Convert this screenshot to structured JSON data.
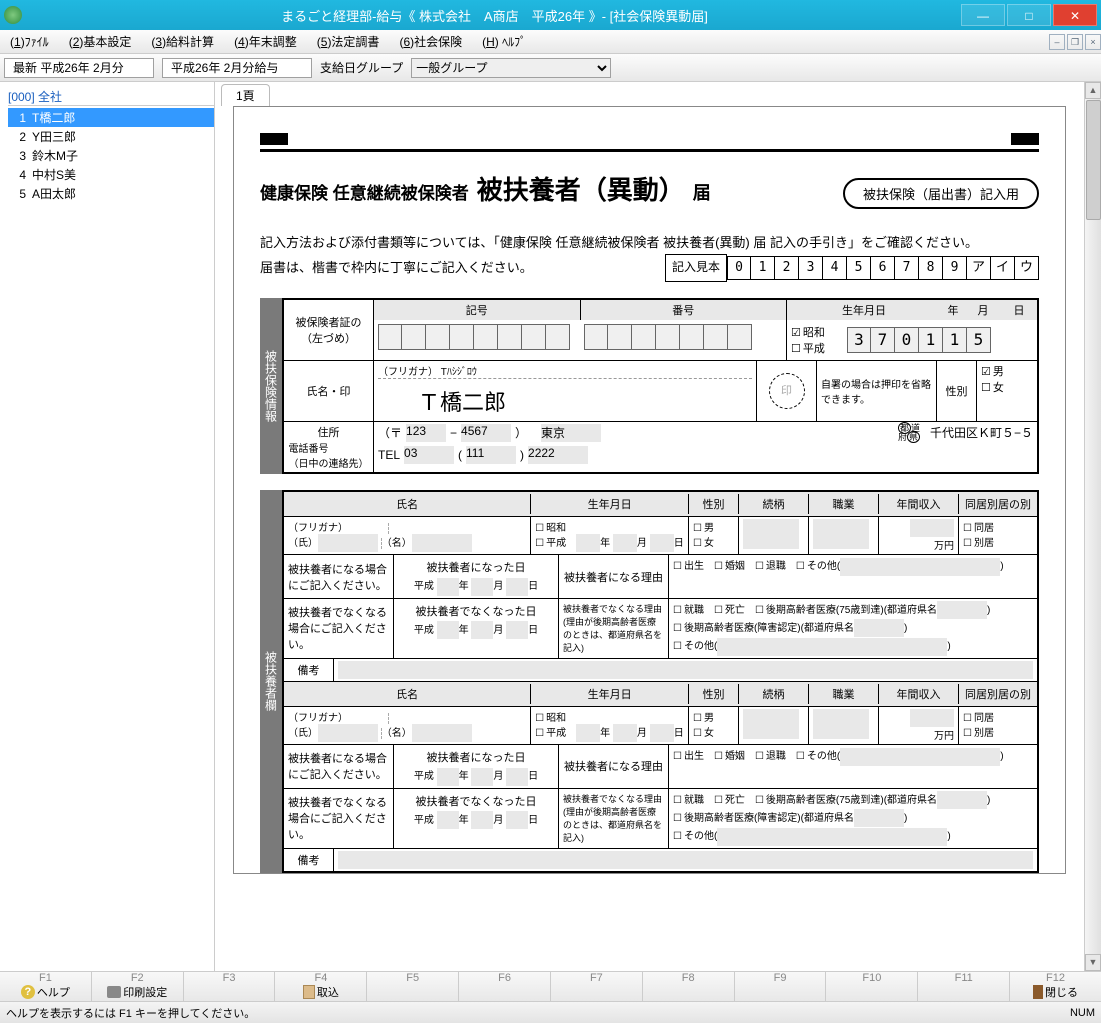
{
  "titlebar": {
    "title": "まるごと経理部-給与《 株式会社　A商店　平成26年 》- [社会保険異動届]"
  },
  "menu": [
    {
      "u": "1",
      "t": ")ﾌｧｲﾙ"
    },
    {
      "u": "2",
      "t": ")基本設定"
    },
    {
      "u": "3",
      "t": ")給料計算"
    },
    {
      "u": "4",
      "t": ")年末調整"
    },
    {
      "u": "5",
      "t": ")法定調書"
    },
    {
      "u": "6",
      "t": ")社会保険"
    },
    {
      "u": "H",
      "t": ") ﾍﾙﾌﾟ"
    }
  ],
  "toolbar": {
    "field1": "最新 平成26年 2月分",
    "field2": "平成26年 2月分給与",
    "label": "支給日グループ",
    "select": "一般グループ"
  },
  "sidebar": {
    "header": "[000] 全社",
    "items": [
      {
        "n": "1",
        "name": "T橋二郎",
        "sel": true
      },
      {
        "n": "2",
        "name": "Y田三郎"
      },
      {
        "n": "3",
        "name": "鈴木M子"
      },
      {
        "n": "4",
        "name": "中村S美"
      },
      {
        "n": "5",
        "name": "A田太郎"
      }
    ]
  },
  "doc": {
    "tab": "1頁",
    "title_small": "健康保険 任意継続被保険者",
    "title_big": "被扶養者（異動）",
    "title_med": "届",
    "badge": "被扶保険（届出書）記入用",
    "instr1": "記入方法および添付書類等については、「健康保険 任意継続被保険者 被扶養者(異動) 届 記入の手引き」をご確認ください。",
    "instr2": "届書は、楷書で枠内に丁寧にご記入ください。",
    "sample_label": "記入見本",
    "sample_boxes": [
      "0",
      "1",
      "2",
      "3",
      "4",
      "5",
      "6",
      "7",
      "8",
      "9",
      "ア",
      "イ",
      "ウ"
    ],
    "section1_label": "被扶保険情報",
    "kigou": "記号",
    "bangou": "番号",
    "birth": "生年月日",
    "year": "年",
    "month": "月",
    "day": "日",
    "showa": "昭和",
    "heisei": "平成",
    "birth_digits": [
      "3",
      "7",
      "0",
      "1",
      "1",
      "5"
    ],
    "hihokensha_label": "被保険者証の\n（左づめ）",
    "furigana_label": "（フリガナ）",
    "furigana": "Tﾊｼｼﾞﾛｳ",
    "name_label": "氏名・印",
    "name": "Ｔ橋二郎",
    "seal": "印",
    "seal_note": "自署の場合は押印を省略できます。",
    "sex_label": "性別",
    "male": "男",
    "female": "女",
    "addr_label": "住所",
    "postal_mark": "（〒",
    "postal1": "123",
    "dash": "−",
    "postal2": "4567",
    "postal_close": "）",
    "pref": "東京",
    "city": "千代田区Ｋ町５−５",
    "pref_hdr1": "都",
    "pref_hdr2": "道",
    "pref_hdr3": "府",
    "pref_hdr4": "県",
    "tel_label": "電話番号\n（日中の連絡先）",
    "tel_prefix": "TEL",
    "tel1": "03",
    "tel2": "111",
    "tel3": "2222",
    "p_open": "(",
    "p_close": ")",
    "section2_label": "被扶養者欄",
    "dep_headers": {
      "name": "氏名",
      "birth": "生年月日",
      "sex": "性別",
      "rel": "続柄",
      "job": "職業",
      "income": "年間収入",
      "sep": "同居別居の別"
    },
    "furigana2": "（フリガナ）",
    "shi": "（氏）",
    "mei": "（名）",
    "man": "万円",
    "doukyo": "同居",
    "bekkyo": "別居",
    "become_case": "被扶養者になる場合にご記入ください。",
    "became_date": "被扶養者になった日",
    "reason_become": "被扶養者になる理由",
    "birth_opt": "出生",
    "marry": "婚姻",
    "retire": "退職",
    "other": "その他(",
    "notcase": "被扶養者でなくなる場合にご記入ください。",
    "notdate": "被扶養者でなくなった日",
    "reason_not": "被扶養者でなくなる理由\n(理由が後期高齢者医療のときは、都道府県名を記入)",
    "job_opt": "就職",
    "death": "死亡",
    "late75": "後期高齢者医療(75歳到達)(都道府県名",
    "late_dis": "後期高齢者医療(障害認定)(都道府県名",
    "biko": "備考"
  },
  "fkeys": [
    "F1",
    "F2",
    "F3",
    "F4",
    "F5",
    "F6",
    "F7",
    "F8",
    "F9",
    "F10",
    "F11",
    "F12"
  ],
  "fcap": {
    "F1": "ヘルプ",
    "F2": "印刷設定",
    "F4": "取込",
    "F12": "閉じる"
  },
  "status": {
    "msg": "ヘルプを表示するには F1 キーを押してください。",
    "right": "NUM"
  }
}
